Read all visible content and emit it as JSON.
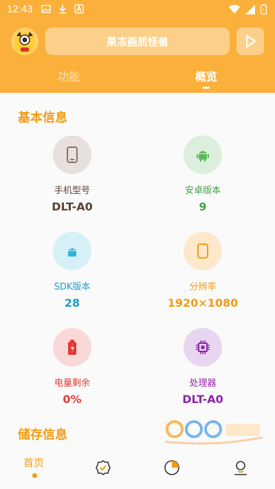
{
  "status": {
    "time": "12:43"
  },
  "header": {
    "app_title": "果冻画质怪兽",
    "tabs": [
      {
        "label": "功能"
      },
      {
        "label": "概览"
      }
    ]
  },
  "basic_info": {
    "title": "基本信息",
    "items": [
      {
        "label": "手机型号",
        "value": "DLT-A0",
        "icon": "phone-icon",
        "color": "#5d4037",
        "bg": "#e8e0dc"
      },
      {
        "label": "安卓版本",
        "value": "9",
        "icon": "android-icon",
        "color": "#43a047",
        "bg": "#dcefdc"
      },
      {
        "label": "SDK版本",
        "value": "28",
        "icon": "android-robot-icon",
        "color": "#1ba0c9",
        "bg": "#d6f0f7"
      },
      {
        "label": "分辨率",
        "value": "1920×1080",
        "icon": "screen-icon",
        "color": "#f39c12",
        "bg": "#fde8cc"
      },
      {
        "label": "电量剩余",
        "value": "0%",
        "icon": "battery-icon",
        "color": "#e53935",
        "bg": "#f9d9d8"
      },
      {
        "label": "处理器",
        "value": "DLT-A0",
        "icon": "chip-icon",
        "color": "#8e24aa",
        "bg": "#e8d5ef"
      }
    ]
  },
  "storage_info": {
    "title": "储存信息"
  },
  "bottom_nav": {
    "items": [
      {
        "label": "首页",
        "icon": "home-label"
      },
      {
        "label": "",
        "icon": "badge-check-icon"
      },
      {
        "label": "",
        "icon": "pie-chart-icon"
      },
      {
        "label": "",
        "icon": "user-icon"
      }
    ]
  },
  "colors": {
    "accent": "#fbb03b",
    "accent_text": "#f39c12"
  }
}
